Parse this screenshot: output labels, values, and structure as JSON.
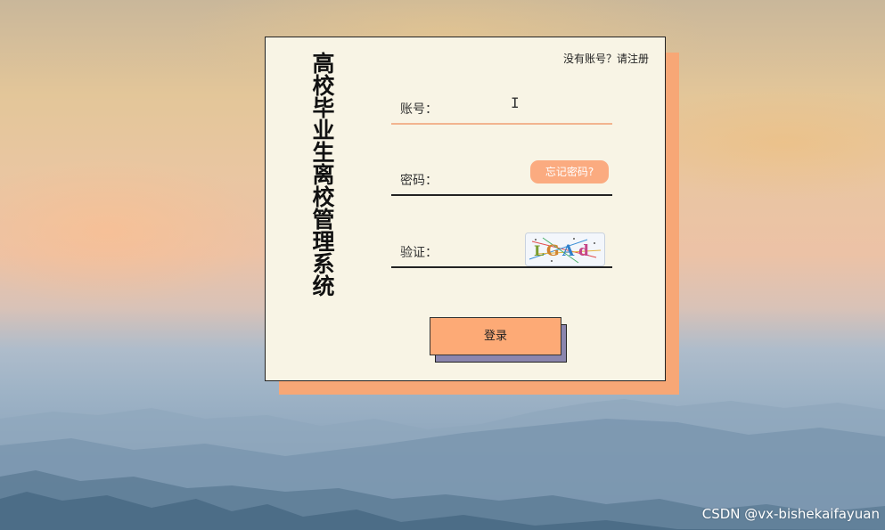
{
  "system_title": "高校毕业生离校管理系统",
  "register_link": "没有账号？请注册",
  "fields": {
    "account_label": "账号：",
    "password_label": "密码：",
    "captcha_label": "验证："
  },
  "forgot_password_label": "忘记密码?",
  "captcha_text": "LGAd",
  "login_label": "登录",
  "watermark": "CSDN @vx-bishekaifayuan",
  "colors": {
    "accent": "#fdaa76",
    "card_bg": "#f8f4e5",
    "card_shadow": "#f7a776",
    "button_shadow": "#8b86ae"
  }
}
